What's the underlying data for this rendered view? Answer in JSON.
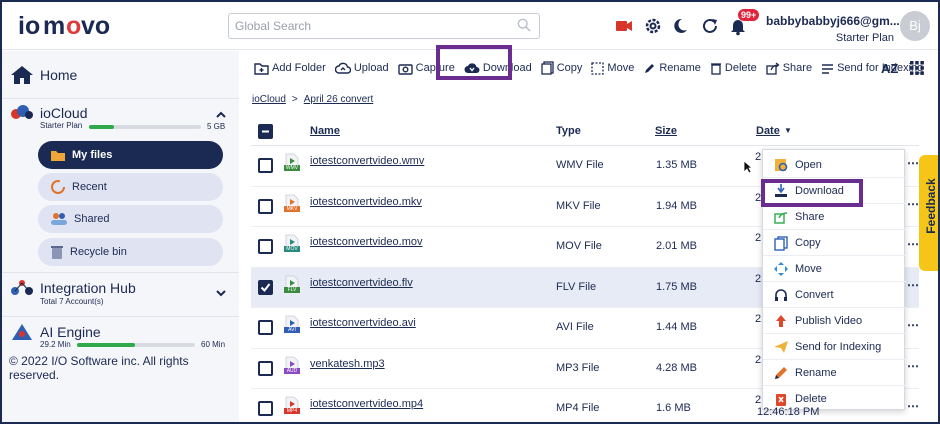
{
  "header": {
    "logo": "iomovo",
    "search_placeholder": "Global Search",
    "notification_count": "99+",
    "user_email": "babbybabbyj666@gm...",
    "user_plan": "Starter Plan",
    "avatar_initials": "Bj"
  },
  "sidebar": {
    "home": "Home",
    "iocloud": {
      "title": "ioCloud",
      "plan": "Starter Plan",
      "storage": "5 GB",
      "usage_fraction": 0.22
    },
    "items": [
      {
        "label": "My files",
        "icon": "folder-icon",
        "active": true
      },
      {
        "label": "Recent",
        "icon": "clock-icon"
      },
      {
        "label": "Shared",
        "icon": "shared-users-icon"
      },
      {
        "label": "Recycle bin",
        "icon": "recycle-icon"
      }
    ],
    "integration": {
      "title": "Integration Hub",
      "sub": "Total 7 Account(s)"
    },
    "ai": {
      "title": "AI Engine",
      "used": "29.2 Min",
      "total": "60 Min",
      "usage_fraction": 0.49
    },
    "copyright": "© 2022 I/O Software inc. All rights reserved."
  },
  "toolbar": {
    "add_folder": "Add Folder",
    "upload": "Upload",
    "capture": "Capture",
    "download": "Download",
    "copy": "Copy",
    "move": "Move",
    "rename": "Rename",
    "delete": "Delete",
    "share": "Share",
    "send_indexing": "Send for Indexing",
    "sort_label": "AZ"
  },
  "breadcrumb": {
    "root": "ioCloud",
    "sep": ">",
    "current": "April 26 convert"
  },
  "table": {
    "headers": {
      "name": "Name",
      "type": "Type",
      "size": "Size",
      "date": "Date"
    },
    "rows": [
      {
        "name": "iotestconvertvideo.wmv",
        "type": "WMV File",
        "size": "1.35 MB",
        "tag": "WMV",
        "color": "#3a8d3f",
        "checked": false
      },
      {
        "name": "iotestconvertvideo.mkv",
        "type": "MKV File",
        "size": "1.94 MB",
        "tag": "MKV",
        "color": "#e0722a",
        "checked": false
      },
      {
        "name": "iotestconvertvideo.mov",
        "type": "MOV File",
        "size": "2.01 MB",
        "tag": "MOV",
        "color": "#2a8a7d",
        "checked": false
      },
      {
        "name": "iotestconvertvideo.flv",
        "type": "FLV File",
        "size": "1.75 MB",
        "tag": "FLV",
        "color": "#3a8d3f",
        "checked": true
      },
      {
        "name": "iotestconvertvideo.avi",
        "type": "AVI File",
        "size": "1.44 MB",
        "tag": "AVI",
        "color": "#2f5fb3",
        "checked": false
      },
      {
        "name": "venkatesh.mp3",
        "type": "MP3 File",
        "size": "4.28 MB",
        "tag": "AUD",
        "color": "#8a4bbf",
        "checked": false
      },
      {
        "name": "iotestconvertvideo.mp4",
        "type": "MP4 File",
        "size": "1.6 MB",
        "tag": "MP4",
        "color": "#d8362b",
        "checked": false
      }
    ],
    "date_fragment": "2",
    "last_time": "12:46:18 PM"
  },
  "context_menu": {
    "items": [
      "Open",
      "Download",
      "Share",
      "Copy",
      "Move",
      "Convert",
      "Publish Video",
      "Send for Indexing",
      "Rename",
      "Delete"
    ]
  },
  "feedback": "Feedback",
  "colors": {
    "brand": "#1b2a52",
    "highlight": "#6a2c8e",
    "accent_green": "#2eaa4a",
    "feedback": "#f5c518"
  }
}
